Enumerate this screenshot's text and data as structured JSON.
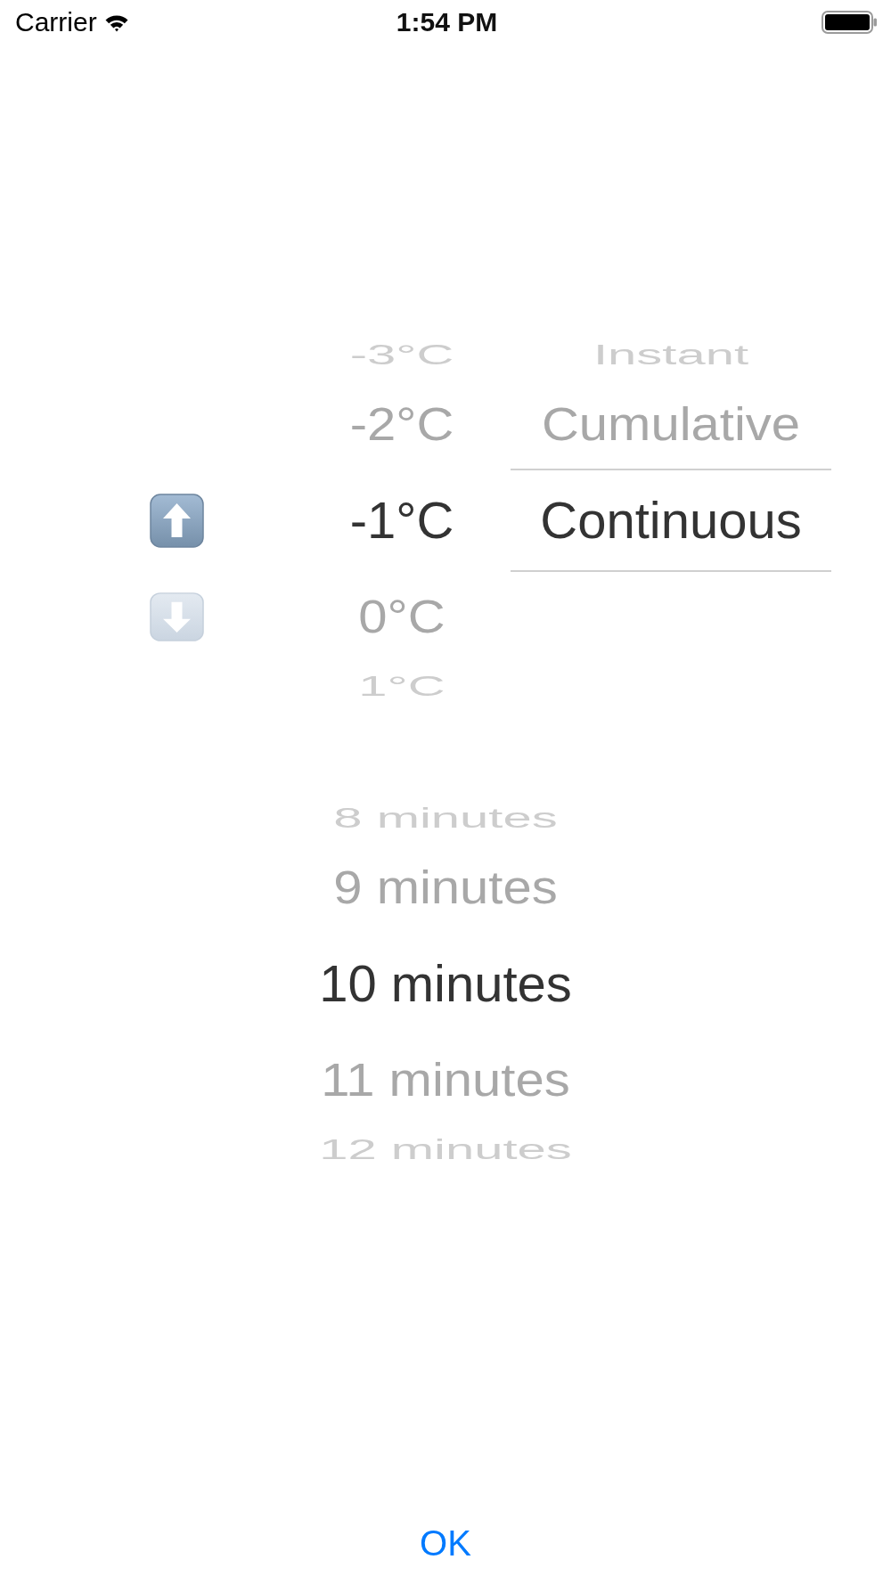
{
  "status_bar": {
    "carrier": "Carrier",
    "time": "1:54 PM"
  },
  "pickers": [
    {
      "columns": [
        {
          "kind": "icon",
          "rows": [
            {
              "kind": "up-arrow",
              "selected": true
            },
            {
              "kind": "down-arrow",
              "selected": false
            }
          ]
        },
        {
          "kind": "text",
          "rows": [
            {
              "label": "-3°C",
              "selected": false
            },
            {
              "label": "-2°C",
              "selected": false
            },
            {
              "label": "-1°C",
              "selected": true
            },
            {
              "label": "0°C",
              "selected": false
            },
            {
              "label": "1°C",
              "selected": false
            }
          ]
        },
        {
          "kind": "text",
          "selection_lines": true,
          "rows": [
            {
              "label": "Instant",
              "selected": false
            },
            {
              "label": "Cumulative",
              "selected": false
            },
            {
              "label": "Continuous",
              "selected": true
            }
          ]
        }
      ]
    },
    {
      "columns": [
        {
          "kind": "text",
          "rows": [
            {
              "label": "8 minutes",
              "selected": false
            },
            {
              "label": "9 minutes",
              "selected": false
            },
            {
              "label": "10 minutes",
              "selected": true
            },
            {
              "label": "11 minutes",
              "selected": false
            },
            {
              "label": "12 minutes",
              "selected": false
            }
          ]
        }
      ]
    }
  ],
  "button": {
    "label": "OK"
  }
}
